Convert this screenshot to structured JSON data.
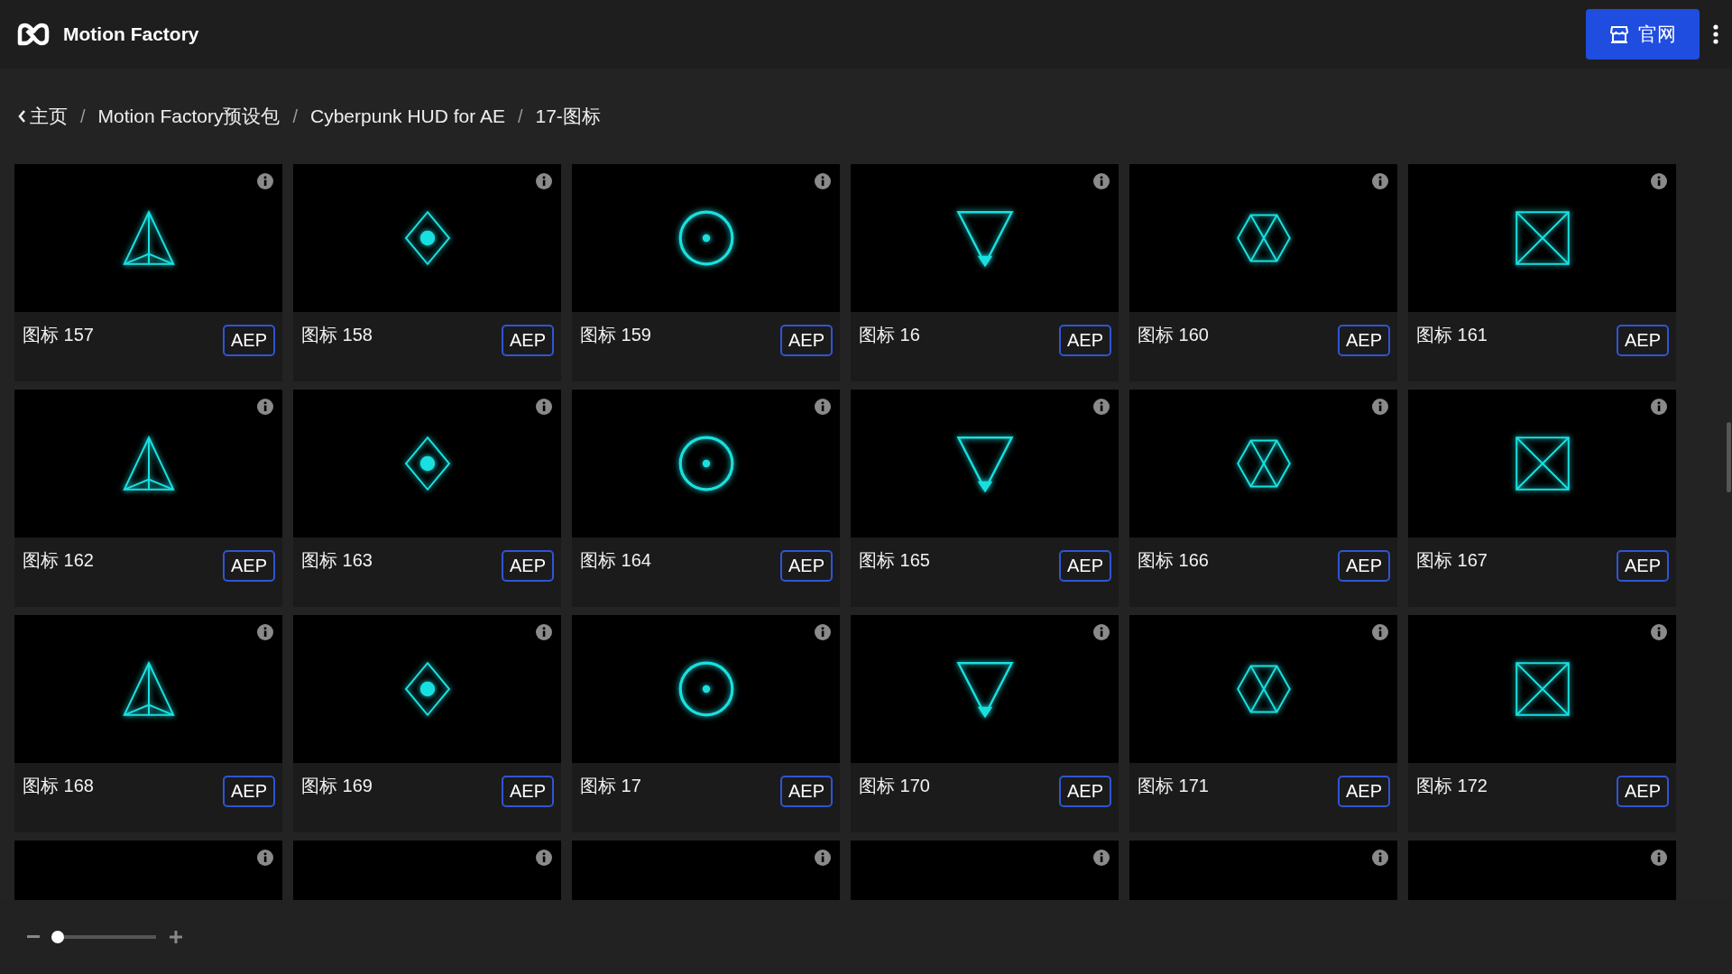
{
  "header": {
    "brand": "Motion Factory",
    "site_button": "官网"
  },
  "breadcrumb": {
    "separator": "/",
    "items": [
      {
        "label": "主页",
        "kind": "back"
      },
      {
        "label": "Motion Factory预设包",
        "kind": "link"
      },
      {
        "label": "Cyberpunk HUD for AE",
        "kind": "link"
      },
      {
        "label": "17-图标",
        "kind": "current"
      }
    ]
  },
  "cards": [
    {
      "title": "图标 157",
      "format": "AEP"
    },
    {
      "title": "图标 158",
      "format": "AEP"
    },
    {
      "title": "图标 159",
      "format": "AEP"
    },
    {
      "title": "图标 16",
      "format": "AEP"
    },
    {
      "title": "图标 160",
      "format": "AEP"
    },
    {
      "title": "图标 161",
      "format": "AEP"
    },
    {
      "title": "图标 162",
      "format": "AEP"
    },
    {
      "title": "图标 163",
      "format": "AEP"
    },
    {
      "title": "图标 164",
      "format": "AEP"
    },
    {
      "title": "图标 165",
      "format": "AEP"
    },
    {
      "title": "图标 166",
      "format": "AEP"
    },
    {
      "title": "图标 167",
      "format": "AEP"
    },
    {
      "title": "图标 168",
      "format": "AEP"
    },
    {
      "title": "图标 169",
      "format": "AEP"
    },
    {
      "title": "图标 17",
      "format": "AEP"
    },
    {
      "title": "图标 170",
      "format": "AEP"
    },
    {
      "title": "图标 171",
      "format": "AEP"
    },
    {
      "title": "图标 172",
      "format": "AEP"
    }
  ],
  "zoom": {
    "level": 0.04
  }
}
